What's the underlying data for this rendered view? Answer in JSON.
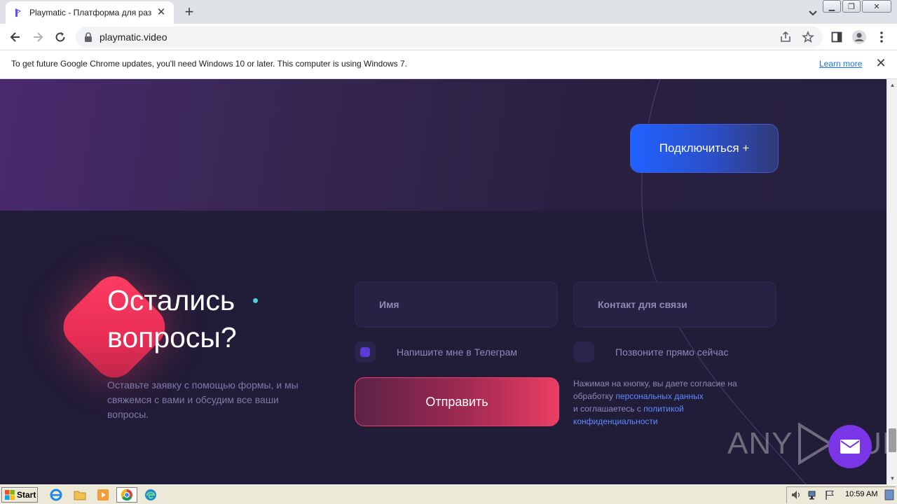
{
  "browser": {
    "tab_title": "Playmatic - Платформа для размещ",
    "url": "playmatic.video",
    "infobar_message": "To get future Google Chrome updates, you'll need Windows 10 or later. This computer is using Windows 7.",
    "infobar_link": "Learn more"
  },
  "hero": {
    "connect_button": "Подключиться +"
  },
  "contact": {
    "heading_line1": "Остались",
    "heading_line2": "вопросы?",
    "subtext": "Оставьте заявку с помощью формы, и мы свяжемся с вами и обсудим все ваши вопросы.",
    "name_placeholder": "Имя",
    "contact_placeholder": "Контакт для связи",
    "option_telegram": "Напишите мне в Телеграм",
    "option_call": "Позвоните прямо сейчас",
    "submit_button": "Отправить",
    "consent_text_1": "Нажимая на кнопку, вы даете согласие на обработку",
    "consent_link_1": "персональных данных",
    "consent_text_2": "и соглашаетесь с",
    "consent_link_2": "политикой конфиденциальности",
    "telegram_selected": true
  },
  "watermark": {
    "left": "ANY",
    "right": "RUN"
  },
  "taskbar": {
    "start_label": "Start",
    "clock": "10:59 AM"
  },
  "colors": {
    "accent_blue": "#1f62ff",
    "accent_red": "#ec3d63",
    "page_bg": "#211c38"
  }
}
